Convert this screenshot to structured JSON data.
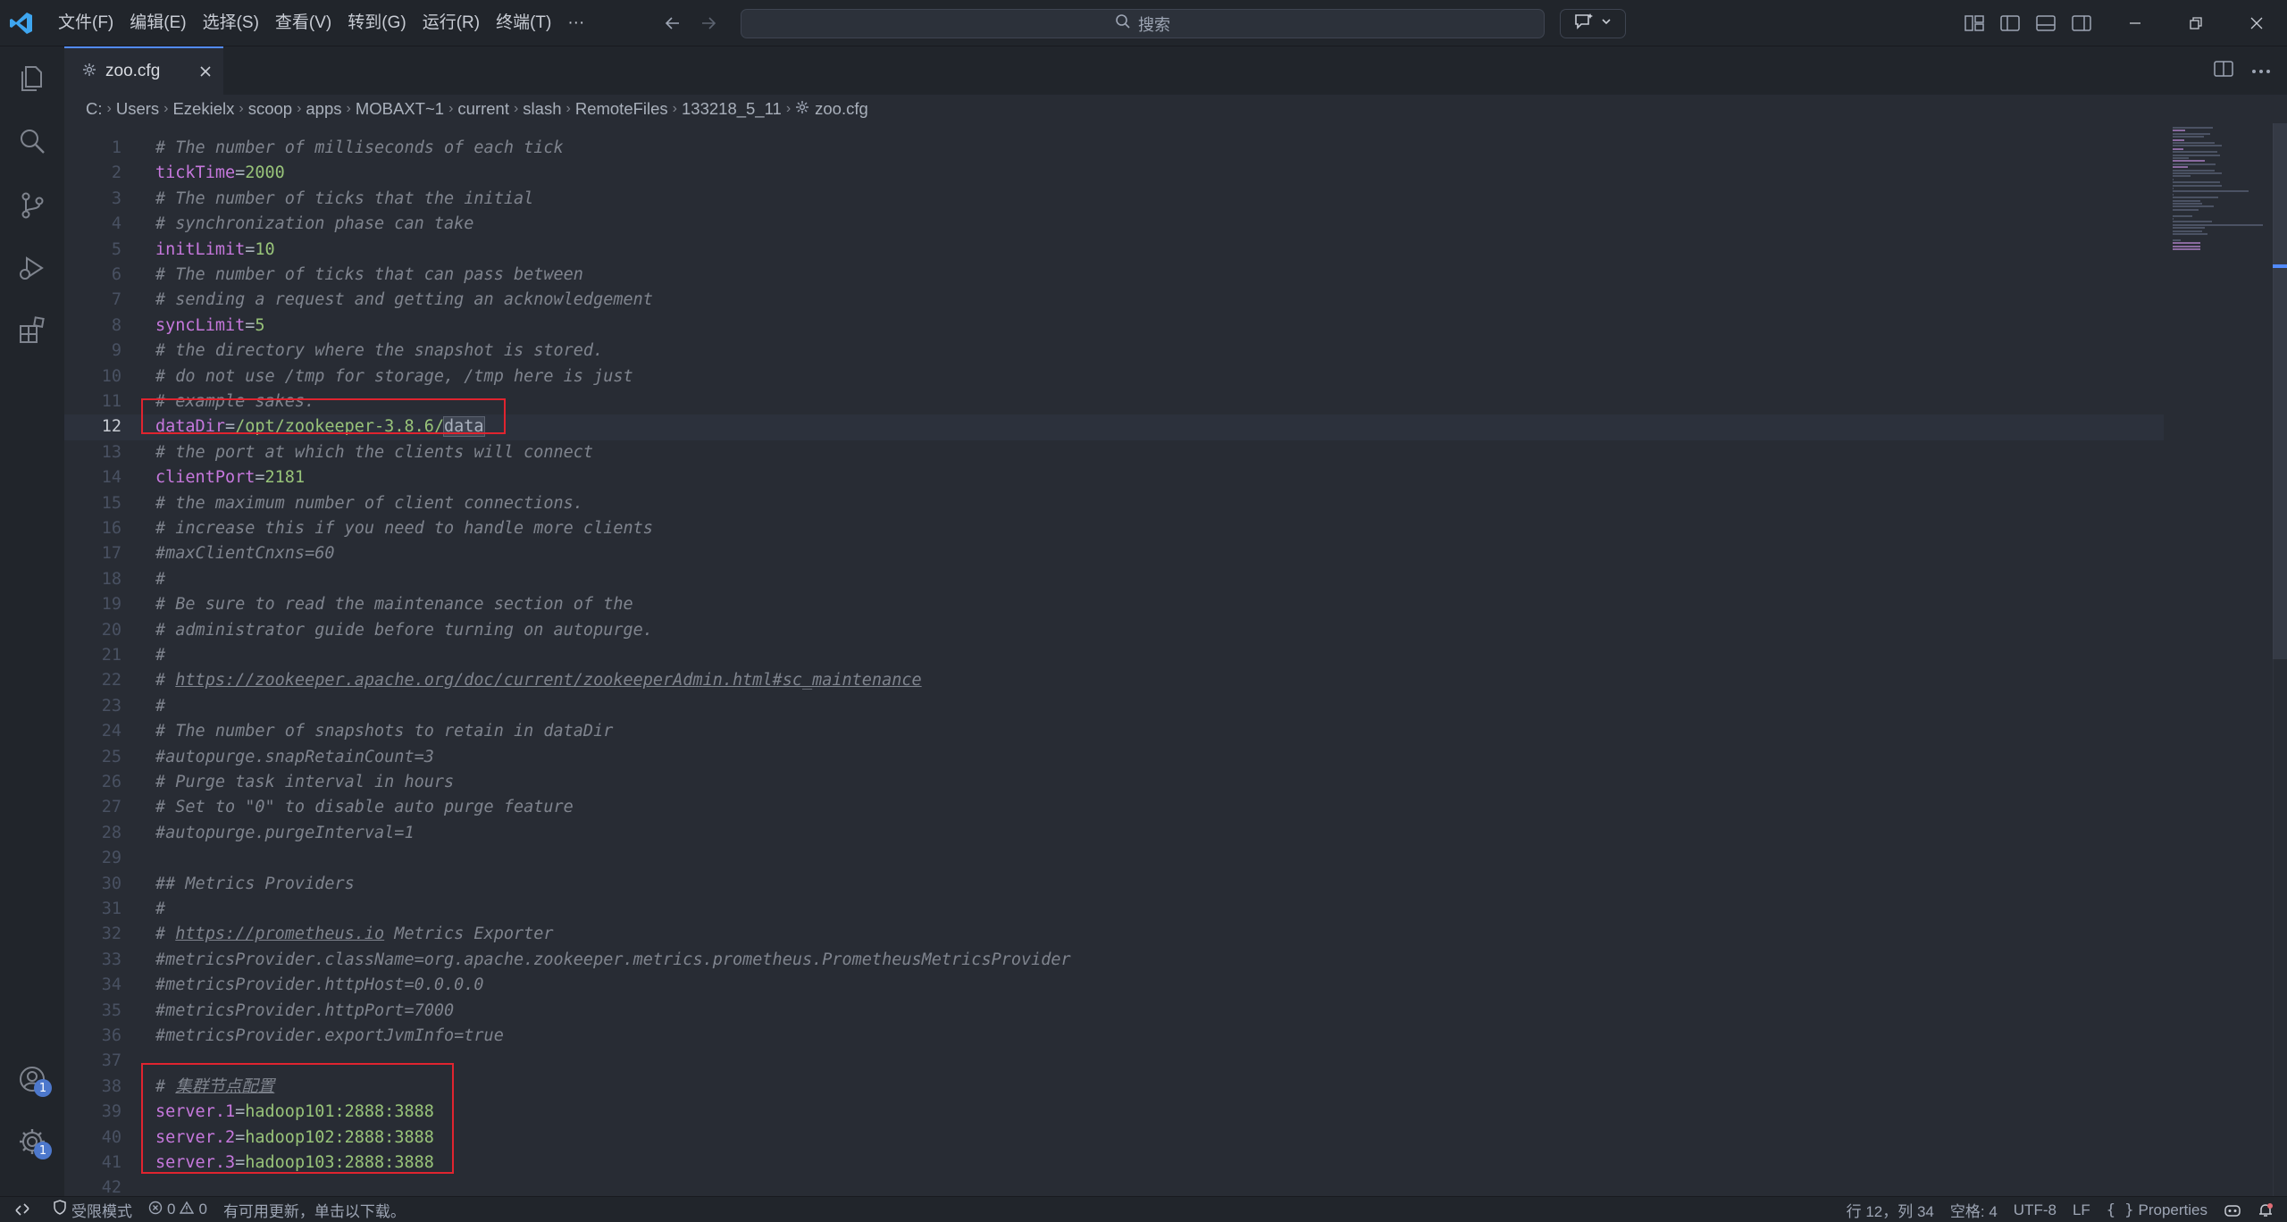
{
  "menu": [
    "文件(F)",
    "编辑(E)",
    "选择(S)",
    "查看(V)",
    "转到(G)",
    "运行(R)",
    "终端(T)",
    "···"
  ],
  "search": {
    "placeholder": "搜索"
  },
  "tab": {
    "label": "zoo.cfg"
  },
  "breadcrumb": [
    "C:",
    "Users",
    "Ezekielx",
    "scoop",
    "apps",
    "MOBAXT~1",
    "current",
    "slash",
    "RemoteFiles",
    "133218_5_11"
  ],
  "breadcrumb_file": "zoo.cfg",
  "activity_badges": {
    "accounts": "1",
    "settings": "1"
  },
  "editor": {
    "active_line": 12,
    "lines": [
      [
        [
          "cmt",
          "# The number of milliseconds of each tick"
        ]
      ],
      [
        [
          "key",
          "tickTime"
        ],
        [
          "op",
          "="
        ],
        [
          "str",
          "2000"
        ]
      ],
      [
        [
          "cmt",
          "# The number of ticks that the initial"
        ]
      ],
      [
        [
          "cmt",
          "# synchronization phase can take"
        ]
      ],
      [
        [
          "key",
          "initLimit"
        ],
        [
          "op",
          "="
        ],
        [
          "str",
          "10"
        ]
      ],
      [
        [
          "cmt",
          "# The number of ticks that can pass between"
        ]
      ],
      [
        [
          "cmt",
          "# sending a request and getting an acknowledgement"
        ]
      ],
      [
        [
          "key",
          "syncLimit"
        ],
        [
          "op",
          "="
        ],
        [
          "str",
          "5"
        ]
      ],
      [
        [
          "cmt",
          "# the directory where the snapshot is stored."
        ]
      ],
      [
        [
          "cmt",
          "# do not use /tmp for storage, /tmp here is just"
        ]
      ],
      [
        [
          "cmt",
          "# example sakes."
        ]
      ],
      [
        [
          "key",
          "dataDir"
        ],
        [
          "op",
          "="
        ],
        [
          "str",
          "/opt/zookeeper-3.8.6/"
        ],
        [
          "sel",
          "data"
        ]
      ],
      [
        [
          "cmt",
          "# the port at which the clients will connect"
        ]
      ],
      [
        [
          "key",
          "clientPort"
        ],
        [
          "op",
          "="
        ],
        [
          "str",
          "2181"
        ]
      ],
      [
        [
          "cmt",
          "# the maximum number of client connections."
        ]
      ],
      [
        [
          "cmt",
          "# increase this if you need to handle more clients"
        ]
      ],
      [
        [
          "cmt",
          "#maxClientCnxns=60"
        ]
      ],
      [
        [
          "cmt",
          "#"
        ]
      ],
      [
        [
          "cmt",
          "# Be sure to read the maintenance section of the"
        ]
      ],
      [
        [
          "cmt",
          "# administrator guide before turning on autopurge."
        ]
      ],
      [
        [
          "cmt",
          "#"
        ]
      ],
      [
        [
          "cmt",
          "# "
        ],
        [
          "link",
          "https://zookeeper.apache.org/doc/current/zookeeperAdmin.html#sc_maintenance"
        ]
      ],
      [
        [
          "cmt",
          "#"
        ]
      ],
      [
        [
          "cmt",
          "# The number of snapshots to retain in dataDir"
        ]
      ],
      [
        [
          "cmt",
          "#autopurge.snapRetainCount=3"
        ]
      ],
      [
        [
          "cmt",
          "# Purge task interval in hours"
        ]
      ],
      [
        [
          "cmt",
          "# Set to \"0\" to disable auto purge feature"
        ]
      ],
      [
        [
          "cmt",
          "#autopurge.purgeInterval=1"
        ]
      ],
      [],
      [
        [
          "cmt",
          "## Metrics Providers"
        ]
      ],
      [
        [
          "cmt",
          "#"
        ]
      ],
      [
        [
          "cmt",
          "# "
        ],
        [
          "link",
          "https://prometheus.io"
        ],
        [
          "cmt",
          " Metrics Exporter"
        ]
      ],
      [
        [
          "cmt",
          "#metricsProvider.className=org.apache.zookeeper.metrics.prometheus.PrometheusMetricsProvider"
        ]
      ],
      [
        [
          "cmt",
          "#metricsProvider.httpHost=0.0.0.0"
        ]
      ],
      [
        [
          "cmt",
          "#metricsProvider.httpPort=7000"
        ]
      ],
      [
        [
          "cmt",
          "#metricsProvider.exportJvmInfo=true"
        ]
      ],
      [],
      [
        [
          "cmt",
          "# "
        ],
        [
          "cmt-cjk",
          "集群节点配置"
        ]
      ],
      [
        [
          "key",
          "server.1"
        ],
        [
          "op",
          "="
        ],
        [
          "str",
          "hadoop101:2888:3888"
        ]
      ],
      [
        [
          "key",
          "server.2"
        ],
        [
          "op",
          "="
        ],
        [
          "str",
          "hadoop102:2888:3888"
        ]
      ],
      [
        [
          "key",
          "server.3"
        ],
        [
          "op",
          "="
        ],
        [
          "str",
          "hadoop103:2888:3888"
        ]
      ],
      []
    ]
  },
  "status": {
    "restricted_mode": "受限模式",
    "errors": "0",
    "warnings": "0",
    "message": "有可用更新，单击以下载。",
    "cursor": "行 12，列 34",
    "spaces": "空格: 4",
    "encoding": "UTF-8",
    "eol": "LF",
    "language": "Properties"
  },
  "colors": {
    "accent": "#528bff",
    "highlight_box": "#e0242f",
    "keyword": "#c678dd",
    "value": "#98c379",
    "comment": "#7f848e"
  }
}
